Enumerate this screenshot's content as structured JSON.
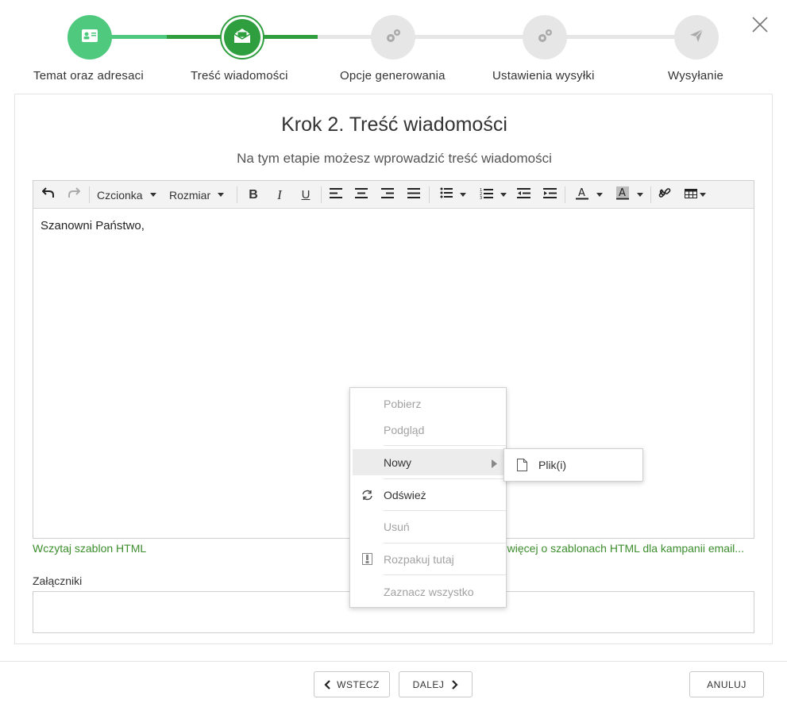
{
  "stepper": {
    "steps": [
      {
        "label": "Temat oraz adresaci",
        "state": "done",
        "icon": "contact-card-icon"
      },
      {
        "label": "Treść wiadomości",
        "state": "active",
        "icon": "open-envelope-icon"
      },
      {
        "label": "Opcje generowania",
        "state": "todo",
        "icon": "gears-icon"
      },
      {
        "label": "Ustawienia wysyłki",
        "state": "todo",
        "icon": "gears-icon"
      },
      {
        "label": "Wysyłanie",
        "state": "todo",
        "icon": "paper-plane-icon"
      }
    ],
    "colors": {
      "done": "#4ec97e",
      "active": "#2e9e3f",
      "todo": "#e6e6e6"
    }
  },
  "main": {
    "title": "Krok 2. Treść wiadomości",
    "subtitle": "Na tym etapie możesz wprowadzić treść wiadomości"
  },
  "editor": {
    "toolbar": {
      "font_label": "Czcionka",
      "size_label": "Rozmiar",
      "buttons": [
        "undo-icon",
        "redo-icon",
        "bold-icon",
        "italic-icon",
        "underline-icon",
        "align-left-icon",
        "align-center-icon",
        "align-right-icon",
        "align-justify-icon",
        "bullet-list-icon",
        "numbered-list-icon",
        "outdent-icon",
        "indent-icon",
        "text-color-icon",
        "background-color-icon",
        "link-icon",
        "table-icon"
      ]
    },
    "content": "Szanowni Państwo,"
  },
  "links": {
    "load_template": "Wczytaj szablon HTML",
    "learn_more": "e więcej o szablonach HTML dla kampanii email..."
  },
  "attachments": {
    "label": "Załączniki"
  },
  "context_menu": {
    "items": [
      {
        "label": "Pobierz",
        "enabled": false
      },
      {
        "label": "Podgląd",
        "enabled": false
      },
      {
        "label": "Nowy",
        "enabled": true,
        "submenu": true
      },
      {
        "label": "Odśwież",
        "enabled": true,
        "icon": "refresh-icon"
      },
      {
        "label": "Usuń",
        "enabled": false
      },
      {
        "label": "Rozpakuj tutaj",
        "enabled": false,
        "icon": "archive-icon"
      },
      {
        "label": "Zaznacz wszystko",
        "enabled": false
      }
    ],
    "submenu": {
      "items": [
        {
          "label": "Plik(i)",
          "icon": "file-icon"
        }
      ]
    }
  },
  "footer": {
    "back_label": "WSTECZ",
    "next_label": "DALEJ",
    "cancel_label": "ANULUJ"
  },
  "accent_color": "#3c8e2d"
}
